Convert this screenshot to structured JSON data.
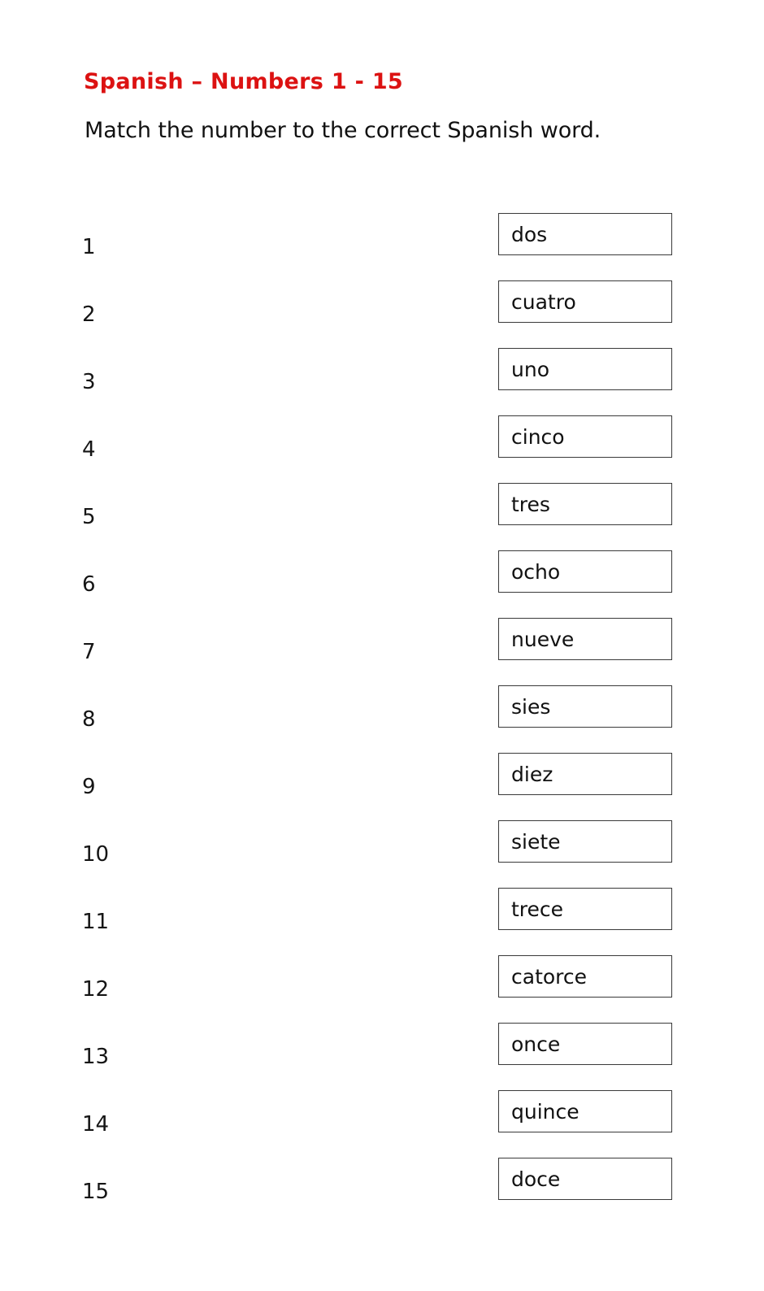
{
  "worksheet": {
    "title": "Spanish – Numbers 1 - 15",
    "instruction": "Match the number to the correct Spanish word.",
    "title_color": "#DC1212",
    "text_color": "#111111",
    "box_border_color": "#3a3a3a",
    "background_color": "#ffffff"
  },
  "rows": [
    {
      "number": "1",
      "word": "dos"
    },
    {
      "number": "2",
      "word": "cuatro"
    },
    {
      "number": "3",
      "word": "uno"
    },
    {
      "number": "4",
      "word": "cinco"
    },
    {
      "number": "5",
      "word": "tres"
    },
    {
      "number": "6",
      "word": "ocho"
    },
    {
      "number": "7",
      "word": "nueve"
    },
    {
      "number": "8",
      "word": "sies"
    },
    {
      "number": "9",
      "word": "diez"
    },
    {
      "number": "10",
      "word": "siete"
    },
    {
      "number": "11",
      "word": "trece"
    },
    {
      "number": "12",
      "word": "catorce"
    },
    {
      "number": "13",
      "word": "once"
    },
    {
      "number": "14",
      "word": "quince"
    },
    {
      "number": "15",
      "word": "doce"
    }
  ]
}
